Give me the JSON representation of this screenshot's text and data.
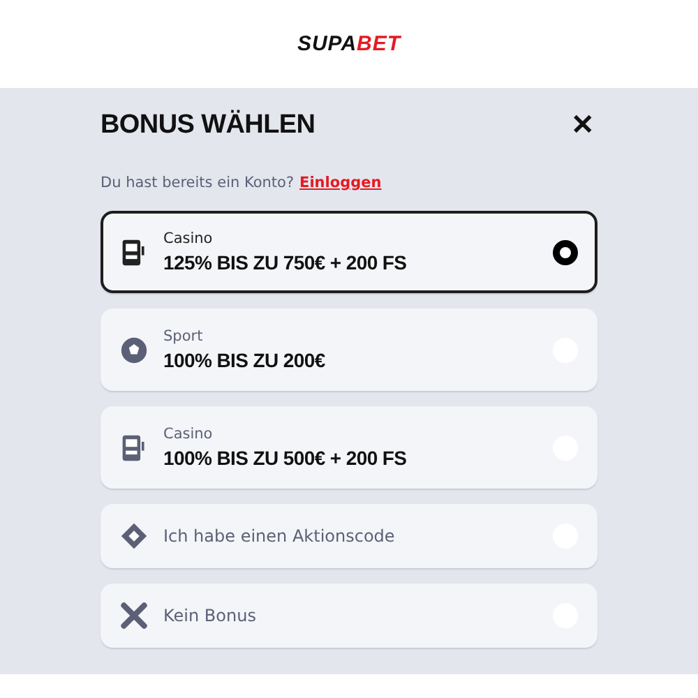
{
  "logo": {
    "part_1": "SUPA",
    "part_2": "BET"
  },
  "dialog": {
    "title": "BONUS WÄHLEN",
    "close": "✕",
    "login_prompt": "Du hast bereits ein Konto?",
    "login_link": "Einloggen"
  },
  "options": [
    {
      "kind": "offer",
      "category": "Casino",
      "title": "125% BIS ZU 750€ + 200 FS",
      "selected": true
    },
    {
      "kind": "offer",
      "category": "Sport",
      "title": "100% BIS ZU 200€",
      "selected": false
    },
    {
      "kind": "offer",
      "category": "Casino",
      "title": "100% BIS ZU 500€ + 200 FS",
      "selected": false
    },
    {
      "kind": "simple",
      "label": "Ich habe einen Aktionscode",
      "selected": false
    },
    {
      "kind": "simple",
      "label": "Kein Bonus",
      "selected": false
    }
  ]
}
